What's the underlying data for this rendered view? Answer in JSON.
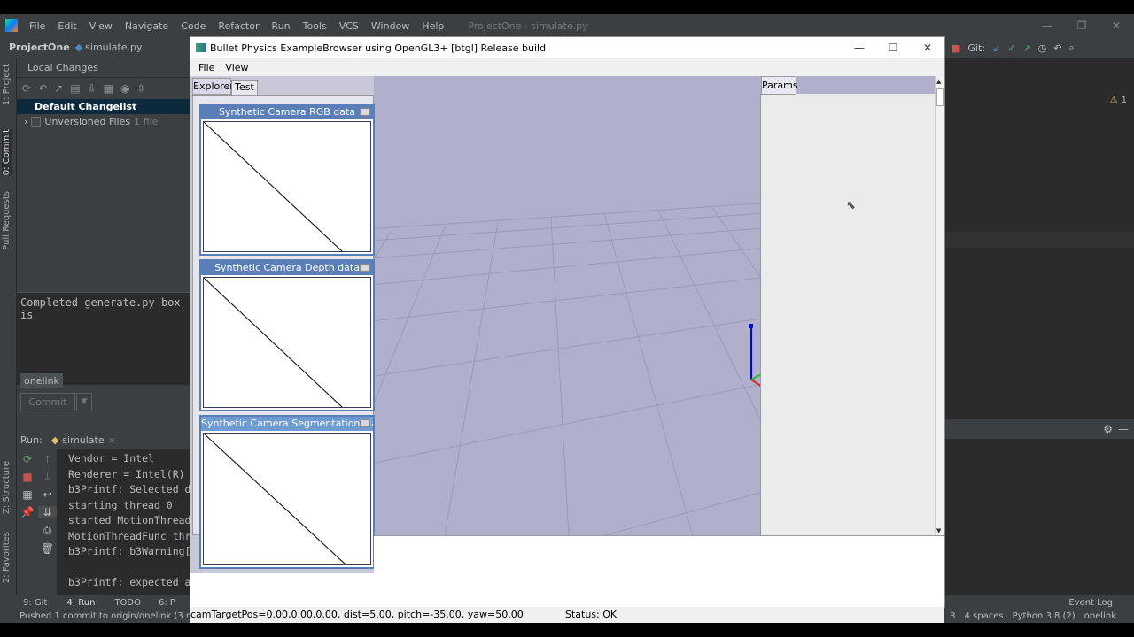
{
  "ide": {
    "menu": [
      "File",
      "Edit",
      "View",
      "Navigate",
      "Code",
      "Refactor",
      "Run",
      "Tools",
      "VCS",
      "Window",
      "Help"
    ],
    "window_title": "ProjectOne - simulate.py",
    "project": "ProjectOne",
    "file": "simulate.py",
    "left_tabs": [
      "1: Project",
      "0: Commit",
      "Pull Requests"
    ],
    "bottom_left_tabs": [
      "Z: Structure",
      "2: Favorites"
    ],
    "commit": {
      "header": "Local Changes",
      "changelist": "Default Changelist",
      "unversioned": "Unversioned Files",
      "unversioned_count": "1 file",
      "message": "Completed generate.py box is",
      "branch_tag": "onelink",
      "commit_button": "Commit"
    },
    "run": {
      "label": "Run:",
      "tab": "simulate",
      "console": [
        "Vendor = Intel",
        "Renderer = Intel(R) U",
        "b3Printf: Selected de",
        "starting thread 0",
        "started MotionThreads",
        "MotionThreadFunc thre",
        "b3Printf: b3Warning[e",
        "",
        "b3Printf: expected a"
      ]
    },
    "bottom_tabs": [
      "9: Git",
      "4: Run",
      "TODO",
      "6: P"
    ],
    "event_log": "Event Log",
    "status_left": "Pushed 1 commit to origin/onelink (3 minu",
    "status_right": [
      "8",
      "4 spaces",
      "Python 3.8 (2)",
      "onelink"
    ],
    "git_label": "Git:",
    "warnings": "1"
  },
  "bullet": {
    "title": "Bullet Physics ExampleBrowser using OpenGL3+ [btgl] Release build",
    "menu": [
      "File",
      "View"
    ],
    "tabs": [
      "Explorer",
      "Test"
    ],
    "camera_windows": [
      "Synthetic Camera RGB data",
      "Synthetic Camera Depth data",
      "Synthetic Camera Segmentation Mask"
    ],
    "params_tab": "Params",
    "status_cam": "camTargetPos=0.00,0.00,0.00, dist=5.00, pitch=-35.00, yaw=50.00",
    "status": "Status: OK"
  },
  "colors": {
    "viewport_bg": "#b0b0cc",
    "cube": "#a8a8a8",
    "ide_bg": "#3c3f41",
    "editor_bg": "#2b2b2b"
  }
}
